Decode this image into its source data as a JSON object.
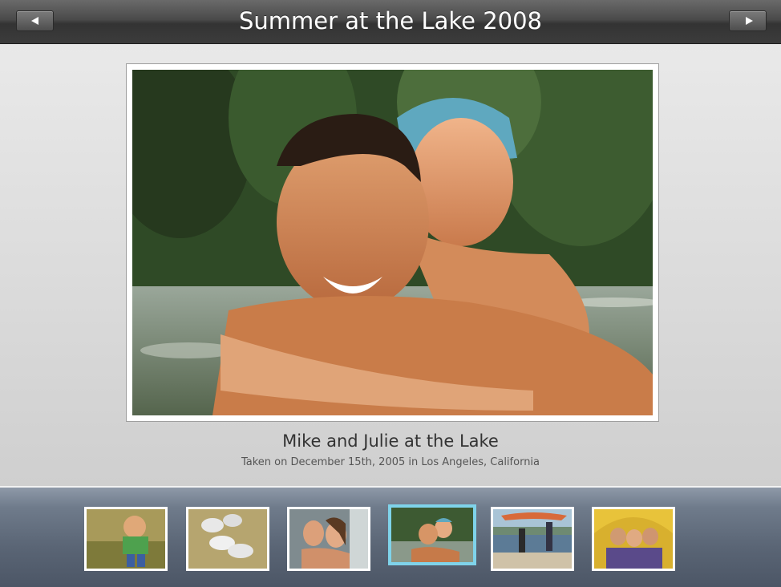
{
  "header": {
    "title": "Summer at the Lake 2008",
    "prev_icon": "triangle-left-icon",
    "next_icon": "triangle-right-icon"
  },
  "photo": {
    "caption": "Mike and Julie at the Lake",
    "details": "Taken on December 15th, 2005 in Los Angeles, California"
  },
  "thumbnails": [
    {
      "selected": false
    },
    {
      "selected": false
    },
    {
      "selected": false
    },
    {
      "selected": true
    },
    {
      "selected": false
    },
    {
      "selected": false
    }
  ],
  "colors": {
    "selected_border": "#7fd3ea",
    "header_bg": "#3c3c3c",
    "filmstrip_bg": "#5a6575"
  }
}
